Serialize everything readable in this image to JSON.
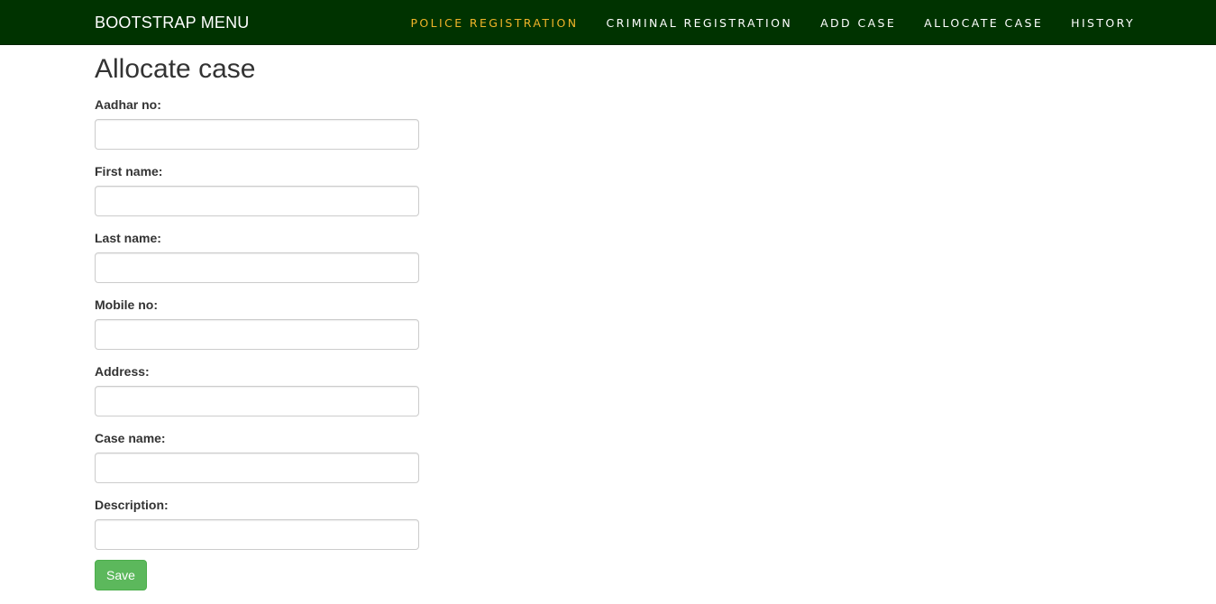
{
  "navbar": {
    "brand": "BOOTSTRAP MENU",
    "items": [
      {
        "label": "POLICE REGISTRATION",
        "active": true
      },
      {
        "label": "CRIMINAL REGISTRATION",
        "active": false
      },
      {
        "label": "ADD CASE",
        "active": false
      },
      {
        "label": "ALLOCATE CASE",
        "active": false
      },
      {
        "label": "HISTORY",
        "active": false
      }
    ],
    "background_color": "#003300",
    "active_color": "#f0b429"
  },
  "page": {
    "title": "Allocate case"
  },
  "form": {
    "fields": [
      {
        "label": "Aadhar no:",
        "value": ""
      },
      {
        "label": "First name:",
        "value": ""
      },
      {
        "label": "Last name:",
        "value": ""
      },
      {
        "label": "Mobile no:",
        "value": ""
      },
      {
        "label": "Address:",
        "value": ""
      },
      {
        "label": "Case name:",
        "value": ""
      },
      {
        "label": "Description:",
        "value": ""
      }
    ],
    "save_label": "Save",
    "save_color": "#5cb85c"
  }
}
